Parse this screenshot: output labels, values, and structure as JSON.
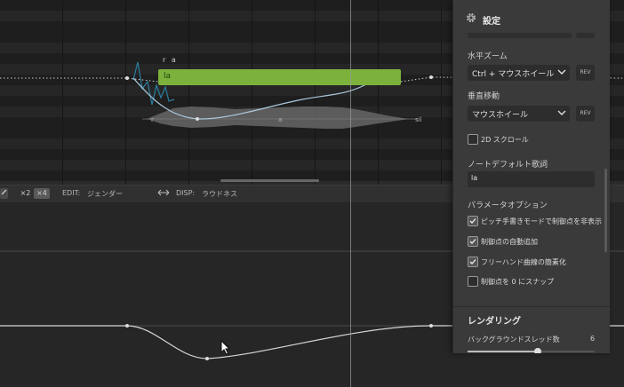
{
  "note": {
    "lyric": "la",
    "phoneme_label": "r a",
    "color": "#7cb13c"
  },
  "phonemes": [
    "r",
    "a",
    "sil"
  ],
  "toolbar": {
    "x2": "×2",
    "x4": "×4",
    "edit_label": "EDIT:",
    "edit_value": "ジェンダー",
    "swap_icon": "swap-arrows-icon",
    "disp_label": "DISP:",
    "disp_value": "ラウドネス"
  },
  "settings": {
    "title": "設定",
    "horizontal_zoom": {
      "label": "水平ズーム",
      "value": "Ctrl + マウスホイール",
      "rev": "REV"
    },
    "vertical_move": {
      "label": "垂直移動",
      "value": "マウスホイール",
      "rev": "REV"
    },
    "scroll_2d": {
      "label": "2D スクロール",
      "checked": false
    },
    "default_lyric": {
      "label": "ノートデフォルト歌詞",
      "value": "la"
    },
    "param_options": {
      "label": "パラメータオプション",
      "items": [
        {
          "label": "ピッチ手書きモードで制御点を非表示",
          "checked": true
        },
        {
          "label": "制御点の自動追加",
          "checked": true
        },
        {
          "label": "フリーハンド曲線の簡素化",
          "checked": true
        },
        {
          "label": "制御点を 0 にスナップ",
          "checked": false
        }
      ]
    },
    "rendering": {
      "title": "レンダリング",
      "background_threads": {
        "label": "バックグラウンドスレッド数",
        "value": "6",
        "level": 0.55
      }
    }
  },
  "colors": {
    "accent_green": "#7cb13c",
    "pitch_curve": "#a9c9dd",
    "vibrato_line": "#2a7fa0",
    "panel_bg": "#3a3a3a"
  }
}
